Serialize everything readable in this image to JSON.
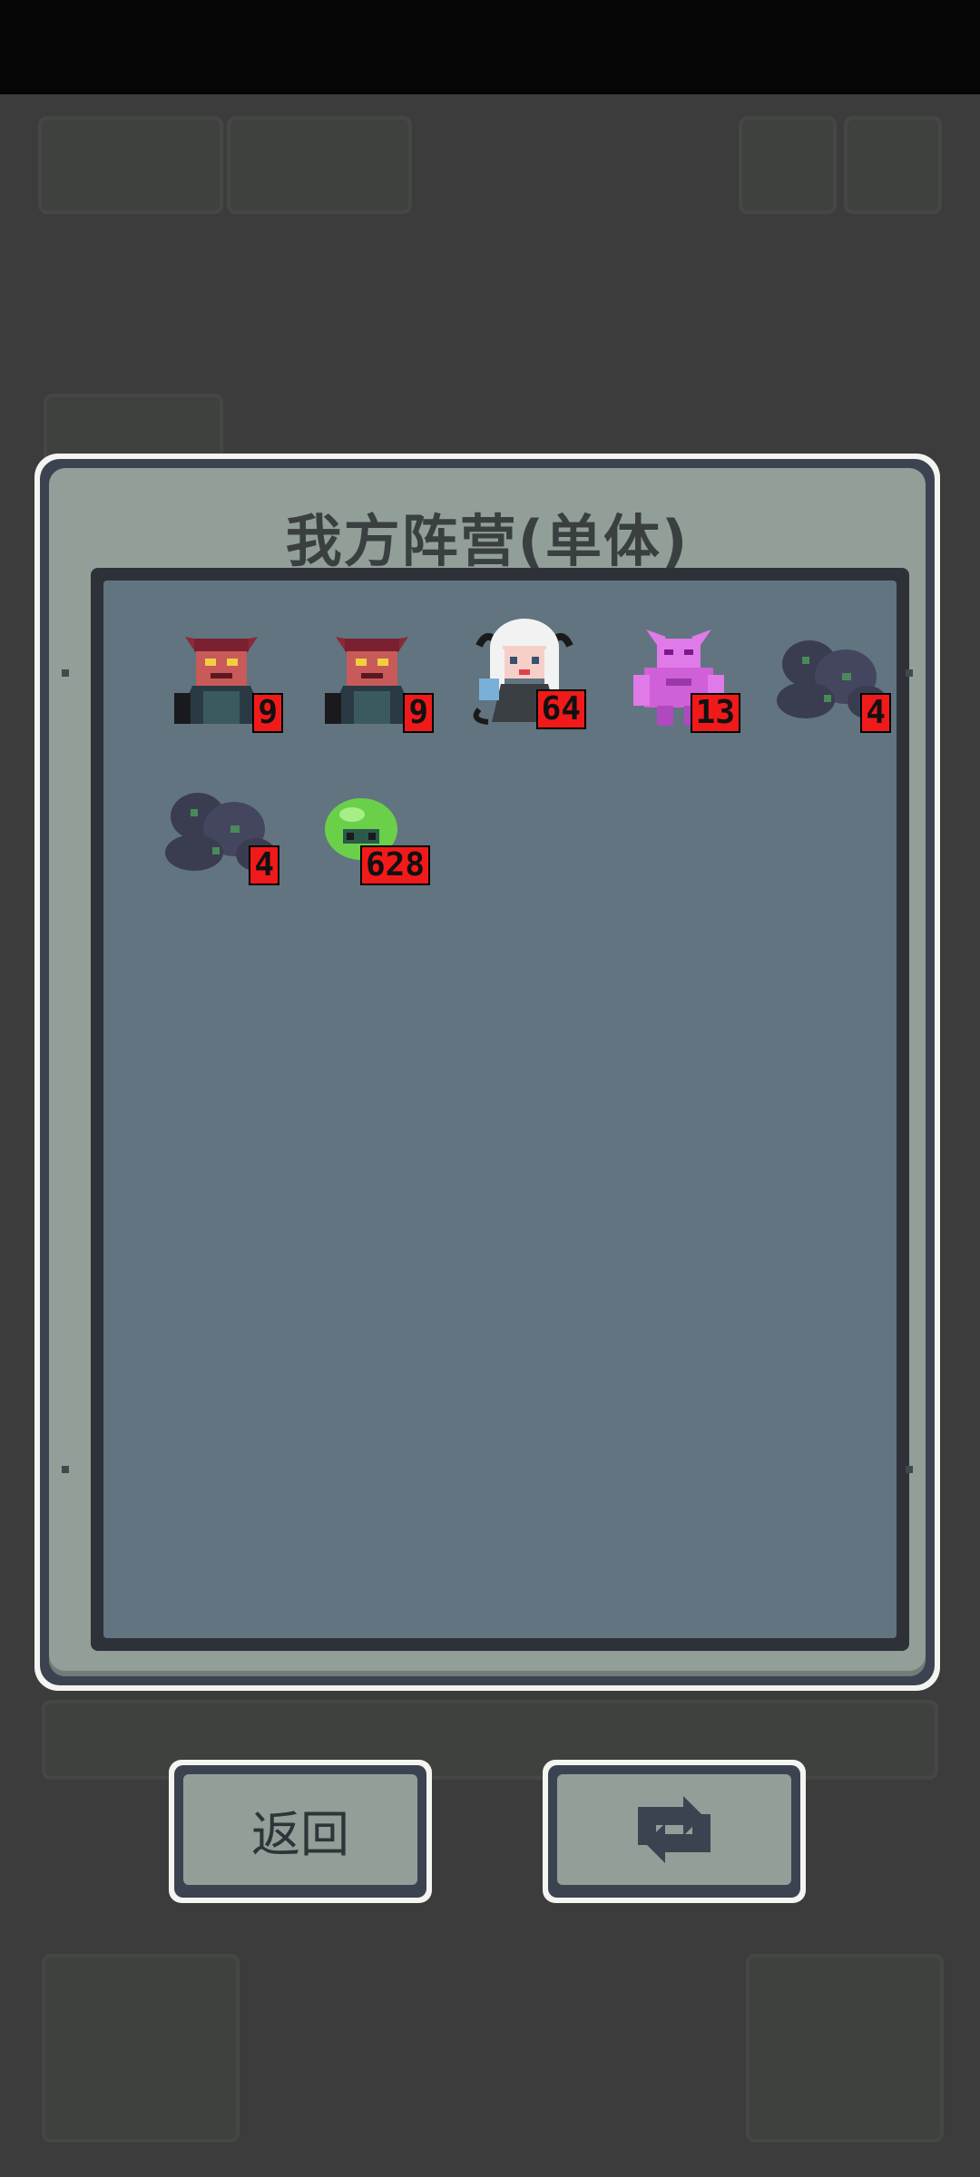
{
  "dialog": {
    "title": "我方阵营(单体)"
  },
  "units": [
    {
      "name": "red-demon-icon",
      "count": "9",
      "color": "#c0404a"
    },
    {
      "name": "red-demon-icon",
      "count": "9",
      "color": "#c0404a"
    },
    {
      "name": "white-haired-girl-icon",
      "count": "64",
      "color": "#f0f0f0"
    },
    {
      "name": "pink-demon-icon",
      "count": "13",
      "color": "#d060d8"
    },
    {
      "name": "rock-golem-icon",
      "count": "4",
      "color": "#3a3c50"
    },
    {
      "name": "rock-golem-icon",
      "count": "4",
      "color": "#3a3c50"
    },
    {
      "name": "green-slime-icon",
      "count": "628",
      "color": "#6ad04a"
    }
  ],
  "buttons": {
    "back_label": "返回",
    "refresh_icon": "refresh-icon"
  }
}
